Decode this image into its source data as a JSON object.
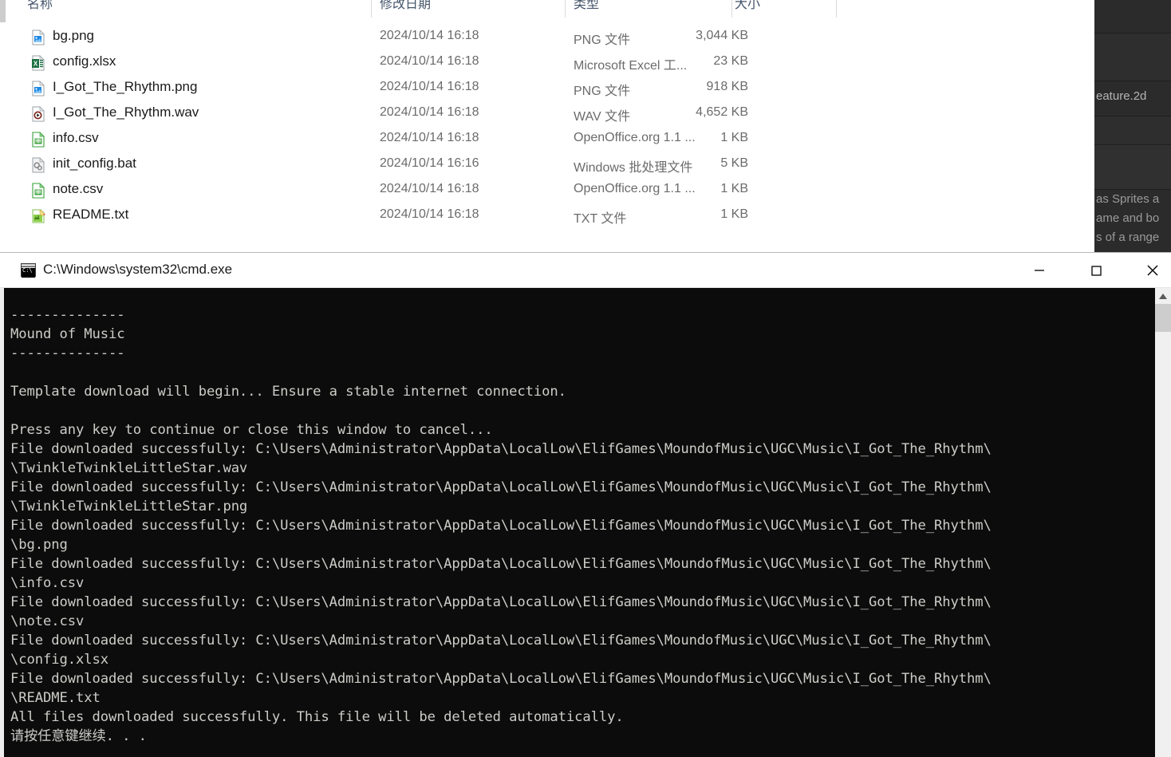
{
  "background_panel": {
    "rows": [
      {
        "label": ""
      },
      {
        "label": ""
      },
      {
        "label": "eature.2d"
      },
      {
        "label": ""
      },
      {
        "label": ""
      }
    ],
    "paragraph_lines": [
      "as Sprites a",
      "ame and bo",
      "s of a range"
    ]
  },
  "explorer": {
    "columns": [
      {
        "key": "name",
        "label": "名称"
      },
      {
        "key": "date",
        "label": "修改日期"
      },
      {
        "key": "type",
        "label": "类型"
      },
      {
        "key": "size",
        "label": "大小"
      }
    ],
    "rows": [
      {
        "icon": "png-image-file-icon",
        "name": "bg.png",
        "date": "2024/10/14 16:18",
        "type": "PNG 文件",
        "size": "3,044 KB"
      },
      {
        "icon": "excel-file-icon",
        "name": "config.xlsx",
        "date": "2024/10/14 16:18",
        "type": "Microsoft Excel 工...",
        "size": "23 KB"
      },
      {
        "icon": "png-image-file-icon",
        "name": "I_Got_The_Rhythm.png",
        "date": "2024/10/14 16:18",
        "type": "PNG 文件",
        "size": "918 KB"
      },
      {
        "icon": "wav-audio-file-icon",
        "name": "I_Got_The_Rhythm.wav",
        "date": "2024/10/14 16:18",
        "type": "WAV 文件",
        "size": "4,652 KB"
      },
      {
        "icon": "csv-spreadsheet-file-icon",
        "name": "info.csv",
        "date": "2024/10/14 16:18",
        "type": "OpenOffice.org 1.1 ...",
        "size": "1 KB"
      },
      {
        "icon": "bat-script-file-icon",
        "name": "init_config.bat",
        "date": "2024/10/14 16:16",
        "type": "Windows 批处理文件",
        "size": "5 KB"
      },
      {
        "icon": "csv-spreadsheet-file-icon",
        "name": "note.csv",
        "date": "2024/10/14 16:18",
        "type": "OpenOffice.org 1.1 ...",
        "size": "1 KB"
      },
      {
        "icon": "txt-file-icon",
        "name": "README.txt",
        "date": "2024/10/14 16:18",
        "type": "TXT 文件",
        "size": "1 KB"
      }
    ]
  },
  "cmd_window": {
    "title": "C:\\Windows\\system32\\cmd.exe",
    "title_icon": "cmd-console-icon",
    "buttons": {
      "minimize": "minimize-icon",
      "maximize": "maximize-icon",
      "close": "close-icon"
    },
    "console_text": "--------------\nMound of Music\n--------------\n\nTemplate download will begin... Ensure a stable internet connection.\n\nPress any key to continue or close this window to cancel...\nFile downloaded successfully: C:\\Users\\Administrator\\AppData\\LocalLow\\ElifGames\\MoundofMusic\\UGC\\Music\\I_Got_The_Rhythm\\\n\\TwinkleTwinkleLittleStar.wav\nFile downloaded successfully: C:\\Users\\Administrator\\AppData\\LocalLow\\ElifGames\\MoundofMusic\\UGC\\Music\\I_Got_The_Rhythm\\\n\\TwinkleTwinkleLittleStar.png\nFile downloaded successfully: C:\\Users\\Administrator\\AppData\\LocalLow\\ElifGames\\MoundofMusic\\UGC\\Music\\I_Got_The_Rhythm\\\n\\bg.png\nFile downloaded successfully: C:\\Users\\Administrator\\AppData\\LocalLow\\ElifGames\\MoundofMusic\\UGC\\Music\\I_Got_The_Rhythm\\\n\\info.csv\nFile downloaded successfully: C:\\Users\\Administrator\\AppData\\LocalLow\\ElifGames\\MoundofMusic\\UGC\\Music\\I_Got_The_Rhythm\\\n\\note.csv\nFile downloaded successfully: C:\\Users\\Administrator\\AppData\\LocalLow\\ElifGames\\MoundofMusic\\UGC\\Music\\I_Got_The_Rhythm\\\n\\config.xlsx\nFile downloaded successfully: C:\\Users\\Administrator\\AppData\\LocalLow\\ElifGames\\MoundofMusic\\UGC\\Music\\I_Got_The_Rhythm\\\n\\README.txt\nAll files downloaded successfully. This file will be deleted automatically.\n请按任意键继续. . .",
    "scrollbar": {
      "up_arrow_icon": "scroll-up-arrow-icon"
    }
  },
  "colors": {
    "console_bg": "#0c0c0c",
    "console_fg": "#ccccc8",
    "titlebar_bg": "#ffffff",
    "explorer_header_fg": "#44546a",
    "unity_panel_bg": "#2b2b2b"
  }
}
